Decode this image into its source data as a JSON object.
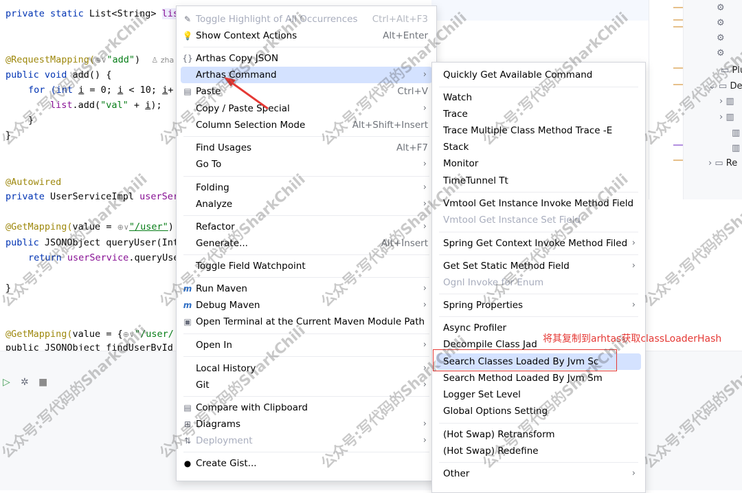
{
  "code": {
    "l1a": "private static ",
    "l1b": "List<String> ",
    "l1c": "lis",
    "l2ann": "@RequestMapping(",
    "l2str": "\"add\"",
    "l2end": ")",
    "l2hint": "zha",
    "l3a": "public void ",
    "l3b": "add() {",
    "l4a": "for (",
    "l4b": "int ",
    "l4c": "i",
    "l4d": " = 0; ",
    "l4e": "i",
    "l4f": " < 10; ",
    "l4g": "i",
    "l4h": "+",
    "l5a": "list",
    "l5b": ".add(",
    "l5c": "\"val\"",
    "l5d": " + ",
    "l5e": "i",
    "l5f": ");",
    "l6": "}",
    "l7": "}",
    "l8": "@Autowired",
    "l9a": "private ",
    "l9b": "UserServiceImpl ",
    "l9c": "userSer",
    "l10a": "@GetMapping(",
    "l10b": "value = ",
    "l10c": "\"/user\"",
    "l10d": ")",
    "l11a": "public ",
    "l11b": "JSONObject queryUser(Int",
    "l12a": "return ",
    "l12b": "userService",
    "l12c": ".queryUse",
    "l13": "}",
    "l14a": "@GetMapping(",
    "l14b": "value = {",
    "l14c": "\"/user/",
    "l15": "public JSONObject findUserById"
  },
  "project": [
    "Plu",
    "De",
    "Re"
  ],
  "menu1": {
    "toggle_highlight": {
      "label": "Toggle Highlight of All Occurrences",
      "shortcut": "Ctrl+Alt+F3"
    },
    "show_context": {
      "label": "Show Context Actions",
      "shortcut": "Alt+Enter"
    },
    "copy_json": {
      "label": "Arthas Copy JSON"
    },
    "arthas_command": {
      "label": "Arthas Command"
    },
    "paste": {
      "label": "Paste",
      "shortcut": "Ctrl+V"
    },
    "copy_paste_special": {
      "label": "Copy / Paste Special"
    },
    "column_selection": {
      "label": "Column Selection Mode",
      "shortcut": "Alt+Shift+Insert"
    },
    "find_usages": {
      "label": "Find Usages",
      "shortcut": "Alt+F7"
    },
    "go_to": {
      "label": "Go To"
    },
    "folding": {
      "label": "Folding"
    },
    "analyze": {
      "label": "Analyze"
    },
    "refactor": {
      "label": "Refactor"
    },
    "generate": {
      "label": "Generate...",
      "shortcut": "Alt+Insert"
    },
    "toggle_field": {
      "label": "Toggle Field Watchpoint"
    },
    "run_maven": {
      "label": "Run Maven"
    },
    "debug_maven": {
      "label": "Debug Maven"
    },
    "open_terminal": {
      "label": "Open Terminal at the Current Maven Module Path"
    },
    "open_in": {
      "label": "Open In"
    },
    "local_history": {
      "label": "Local History"
    },
    "git": {
      "label": "Git"
    },
    "compare_clipboard": {
      "label": "Compare with Clipboard"
    },
    "diagrams": {
      "label": "Diagrams"
    },
    "deployment": {
      "label": "Deployment"
    },
    "create_gist": {
      "label": "Create Gist..."
    }
  },
  "menu2": {
    "quickly_get": "Quickly Get Available Command",
    "watch": "Watch",
    "trace": "Trace",
    "trace_multiple": "Trace Multiple Class Method Trace -E",
    "stack": "Stack",
    "monitor": "Monitor",
    "timetunnel": "TimeTunnel Tt",
    "vmtool_invoke": "Vmtool Get Instance Invoke Method Field",
    "vmtool_set": "Vmtool Get Instance Set Field",
    "spring_context": "Spring Get Context Invoke Method Filed",
    "get_set_static": "Get Set Static Method Field",
    "ognl_enum": "Ognl Invoke for Enum",
    "spring_props": "Spring Properties",
    "async_profiler": "Async Profiler",
    "decompile": "Decompile Class Jad",
    "search_classes": "Search Classes Loaded By Jvm Sc",
    "search_method": "Search Method Loaded By Jvm Sm",
    "logger": "Logger Set Level",
    "global_options": "Global Options Setting",
    "retransform": "(Hot Swap) Retransform",
    "redefine": "(Hot Swap) Redefine",
    "other": "Other"
  },
  "annotation": "将其复制到arhtas获取classLoaderHash",
  "watermark": "公众号:写代码的SharkChili",
  "colors": {
    "accent": "#d4e2ff",
    "annotation_red": "#e53935"
  }
}
